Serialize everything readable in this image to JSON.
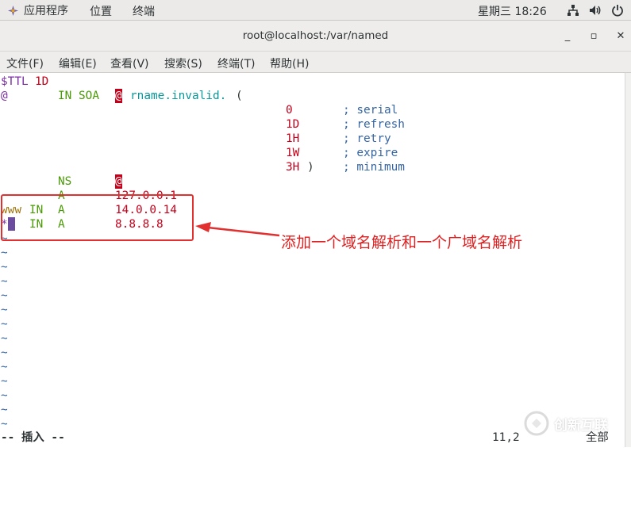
{
  "topbar": {
    "apps_label": "应用程序",
    "places_label": "位置",
    "terminal_label": "终端",
    "clock": "星期三 18:26"
  },
  "window": {
    "title": "root@localhost:/var/named",
    "minimize": "_",
    "maximize": "▫",
    "close": "✕"
  },
  "menubar": {
    "file": "文件(F)",
    "edit": "编辑(E)",
    "view": "查看(V)",
    "search": "搜索(S)",
    "terminal": "终端(T)",
    "help": "帮助(H)"
  },
  "zone": {
    "ttl_kw": "$TTL",
    "ttl_val": "1D",
    "soa_origin": "@",
    "soa_in": "IN SOA",
    "soa_at": "@",
    "soa_rname": "rname.invalid.",
    "soa_paren": "(",
    "serial_val": "0",
    "serial_cmt": "; serial",
    "refresh_val": "1D",
    "refresh_cmt": "; refresh",
    "retry_val": "1H",
    "retry_cmt": "; retry",
    "expire_val": "1W",
    "expire_cmt": "; expire",
    "minimum_val": "3H",
    "minimum_paren": ")",
    "minimum_cmt": "; minimum",
    "ns_type": "NS",
    "ns_val": "@",
    "a_type": "A",
    "a_val": "127.0.0.1",
    "www_name": "www",
    "www_in": "IN",
    "www_type": "A",
    "www_val": "14.0.0.14",
    "wild_name": "*",
    "wild_in": "IN",
    "wild_type": "A",
    "wild_val": "8.8.8.8",
    "tilde": "~"
  },
  "status": {
    "mode": "-- 插入 --",
    "position": "11,2",
    "scroll": "全部"
  },
  "annotation": {
    "text": "添加一个域名解析和一个广域名解析"
  },
  "watermark": {
    "text": "创新互联"
  }
}
